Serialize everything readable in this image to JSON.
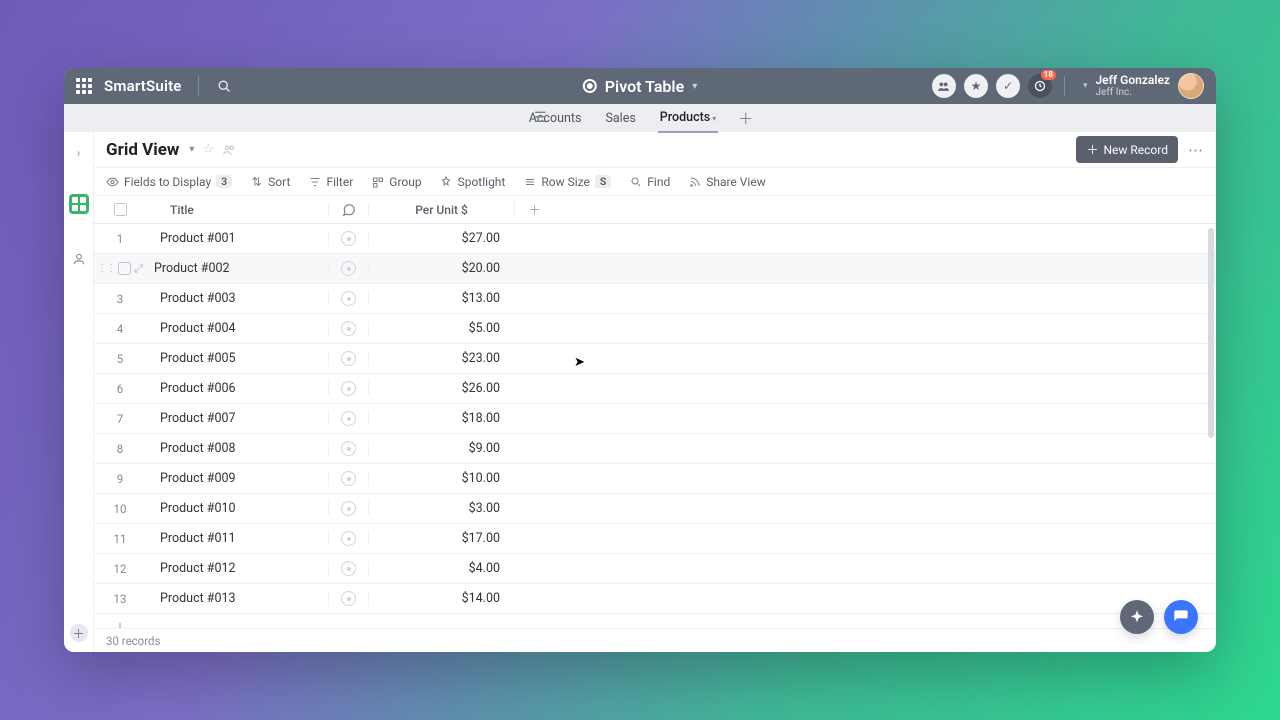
{
  "brand": "SmartSuite",
  "workspace_title": "Pivot Table",
  "notification_count": "18",
  "user": {
    "name": "Jeff Gonzalez",
    "org": "Jeff Inc."
  },
  "tabs": [
    {
      "label": "Accounts",
      "active": false
    },
    {
      "label": "Sales",
      "active": false
    },
    {
      "label": "Products",
      "active": true
    }
  ],
  "view": {
    "name": "Grid View"
  },
  "new_record_label": "New Record",
  "toolbar": {
    "fields": {
      "label": "Fields to Display",
      "count": "3"
    },
    "sort": "Sort",
    "filter": "Filter",
    "group": "Group",
    "spotlight": "Spotlight",
    "rowsize": {
      "label": "Row Size",
      "value": "S"
    },
    "find": "Find",
    "share": "Share View"
  },
  "columns": {
    "title": "Title",
    "price": "Per Unit $"
  },
  "rows": [
    {
      "n": "1",
      "title": "Product #001",
      "price": "$27.00",
      "hovered": false
    },
    {
      "n": "2",
      "title": "Product #002",
      "price": "$20.00",
      "hovered": true
    },
    {
      "n": "3",
      "title": "Product #003",
      "price": "$13.00",
      "hovered": false
    },
    {
      "n": "4",
      "title": "Product #004",
      "price": "$5.00",
      "hovered": false
    },
    {
      "n": "5",
      "title": "Product #005",
      "price": "$23.00",
      "hovered": false
    },
    {
      "n": "6",
      "title": "Product #006",
      "price": "$26.00",
      "hovered": false
    },
    {
      "n": "7",
      "title": "Product #007",
      "price": "$18.00",
      "hovered": false
    },
    {
      "n": "8",
      "title": "Product #008",
      "price": "$9.00",
      "hovered": false
    },
    {
      "n": "9",
      "title": "Product #009",
      "price": "$10.00",
      "hovered": false
    },
    {
      "n": "10",
      "title": "Product #010",
      "price": "$3.00",
      "hovered": false
    },
    {
      "n": "11",
      "title": "Product #011",
      "price": "$17.00",
      "hovered": false
    },
    {
      "n": "12",
      "title": "Product #012",
      "price": "$4.00",
      "hovered": false
    },
    {
      "n": "13",
      "title": "Product #013",
      "price": "$14.00",
      "hovered": false
    }
  ],
  "footer": {
    "records": "30 records"
  }
}
